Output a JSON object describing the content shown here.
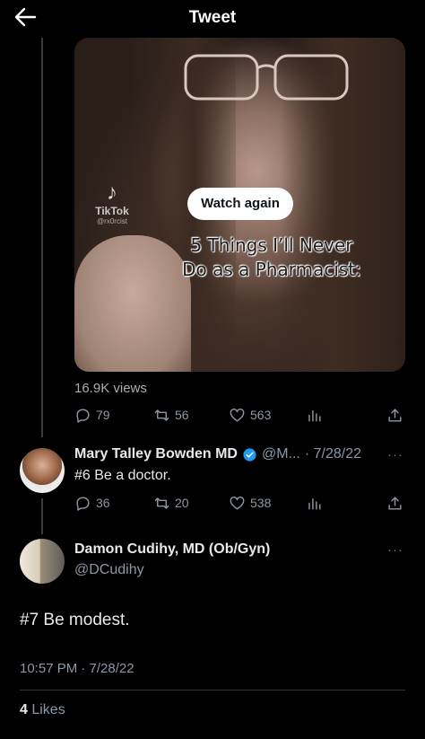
{
  "header": {
    "title": "Tweet",
    "back_icon": "arrow-left-icon"
  },
  "media_tweet": {
    "video": {
      "button_label": "Watch again",
      "overlay_line1": "5 Things I’ll Never",
      "overlay_line2": "Do as a Pharmacist:",
      "watermark_brand": "TikTok",
      "watermark_user": "@rx0rcist"
    },
    "views": "16.9K views",
    "actions": {
      "replies": "79",
      "retweets": "56",
      "likes": "563"
    }
  },
  "reply_1": {
    "name": "Mary Talley Bowden MD",
    "handle": "@M...",
    "date": "· 7/28/22",
    "text": "#6 Be a doctor.",
    "actions": {
      "replies": "36",
      "retweets": "20",
      "likes": "538"
    }
  },
  "reply_2": {
    "name": "Damon Cudihy, MD (Ob/Gyn)",
    "handle": "@DCudihy",
    "text": "#7 Be modest.",
    "timestamp": "10:57 PM · 7/28/22",
    "likes_count": "4",
    "likes_label": " Likes"
  },
  "colors": {
    "background": "#000000",
    "text": "#e7e9ea",
    "muted": "#8b98a5",
    "verified": "#1d9bf0"
  }
}
